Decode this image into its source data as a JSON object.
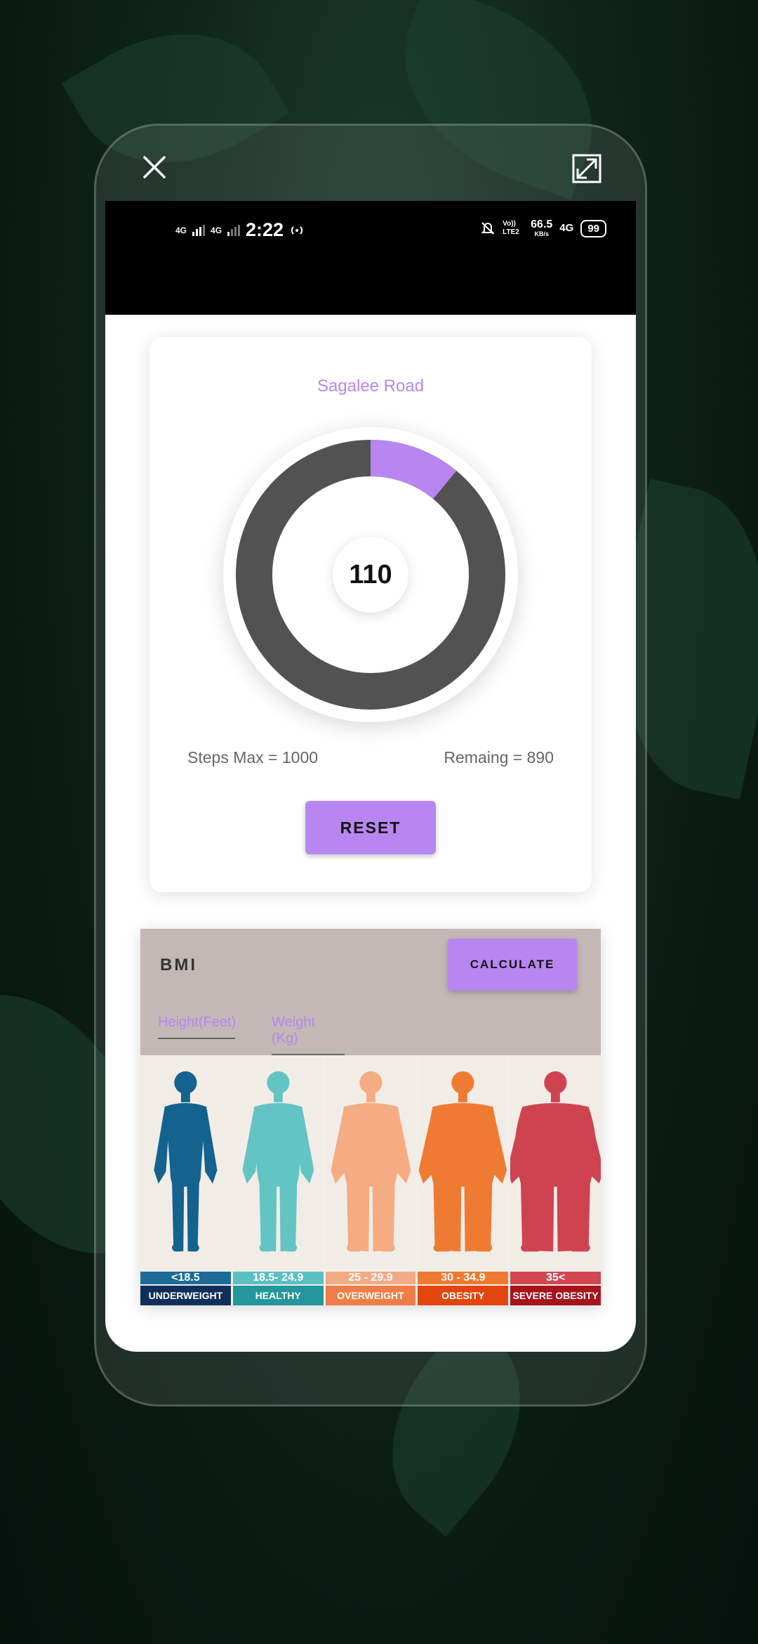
{
  "status_bar": {
    "net1": "4G",
    "net2": "4G",
    "time": "2:22",
    "volte": "Vo)) LTE2",
    "speed": "66.5",
    "speed_unit": "KB/s",
    "net3": "4G",
    "battery": "99"
  },
  "step_card": {
    "title": "Sagalee Road",
    "value": "110",
    "progress_fraction": 0.11,
    "steps_max": "Steps Max = 1000",
    "remaining": "Remaing = 890",
    "reset_label": "RESET"
  },
  "bmi": {
    "title": "BMI",
    "calculate_label": "CALCULATE",
    "height_placeholder": "Height(Feet)",
    "weight_placeholder": "Weight (Kg)",
    "categories": [
      {
        "range": "<18.5",
        "label": "UNDERWEIGHT",
        "fig": "#13638e",
        "range_bg": "#1b6c98",
        "cat_bg": "#0f2f5a",
        "build": 0
      },
      {
        "range": "18.5- 24.9",
        "label": "HEALTHY",
        "fig": "#63c4c4",
        "range_bg": "#5cc0c2",
        "cat_bg": "#23979b",
        "build": 1
      },
      {
        "range": "25 - 29.9",
        "label": "OVERWEIGHT",
        "fig": "#f5ac82",
        "range_bg": "#f2ab84",
        "cat_bg": "#ee7e47",
        "build": 2
      },
      {
        "range": "30 - 34.9",
        "label": "OBESITY",
        "fig": "#ef7b32",
        "range_bg": "#ee7a31",
        "cat_bg": "#e2460f",
        "build": 3
      },
      {
        "range": "35<",
        "label": "SEVERE OBESITY",
        "fig": "#cf4351",
        "range_bg": "#d04752",
        "cat_bg": "#a8141c",
        "build": 4
      }
    ]
  },
  "colors": {
    "accent": "#b886f1",
    "ring_track": "#525252"
  }
}
